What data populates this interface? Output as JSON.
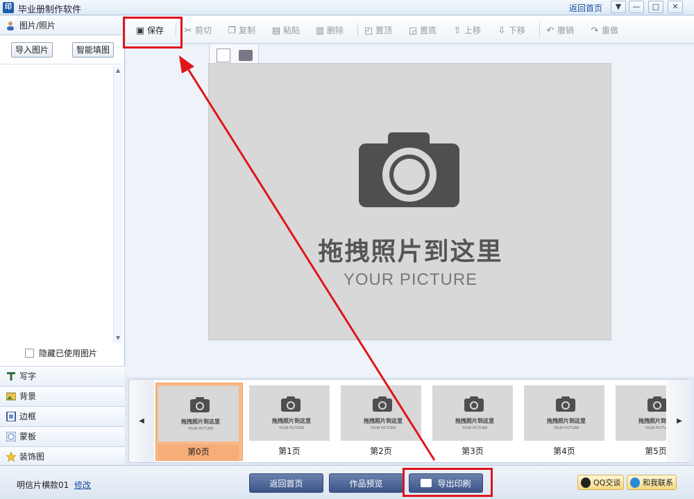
{
  "window": {
    "app_icon_text": "印",
    "title": "毕业册制作软件",
    "back_home_link": "返回首页",
    "controls": [
      "▼",
      "—",
      "□",
      "✕"
    ]
  },
  "left_panel": {
    "photos_header": "图片/照片",
    "import_button": "导入图片",
    "smart_fill_button": "智能填图",
    "hide_used_label": "隐藏已使用图片",
    "tool_tabs": [
      {
        "label": "写字",
        "icon": "text-t-icon"
      },
      {
        "label": "背景",
        "icon": "background-image-icon"
      },
      {
        "label": "边框",
        "icon": "frame-icon"
      },
      {
        "label": "蒙板",
        "icon": "mask-icon"
      },
      {
        "label": "装饰图",
        "icon": "star-icon"
      }
    ]
  },
  "toolbar": {
    "save": "保存",
    "cut": "剪切",
    "copy": "复制",
    "paste": "粘贴",
    "delete": "删除",
    "to_top": "置顶",
    "to_bottom": "置底",
    "move_up": "上移",
    "move_down": "下移",
    "undo": "撤销",
    "redo": "重做"
  },
  "canvas": {
    "placeholder_main": "拖拽照片到这里",
    "placeholder_sub": "YOUR PICTURE"
  },
  "pages": {
    "thumb_main": "拖拽照片到这里",
    "thumb_sub": "YOUR PICTURE",
    "items": [
      "第0页",
      "第1页",
      "第2页",
      "第3页",
      "第4页",
      "第5页"
    ],
    "selected_index": 0,
    "prev_arrow": "◀",
    "next_arrow": "▶"
  },
  "bottom": {
    "template_name": "明信片横款01",
    "edit_link": "修改",
    "back_home_button": "返回首页",
    "preview_button": "作品预览",
    "export_print_button": "导出印刷",
    "qq_chat": "QQ交谈",
    "contact_us": "和我联系"
  }
}
